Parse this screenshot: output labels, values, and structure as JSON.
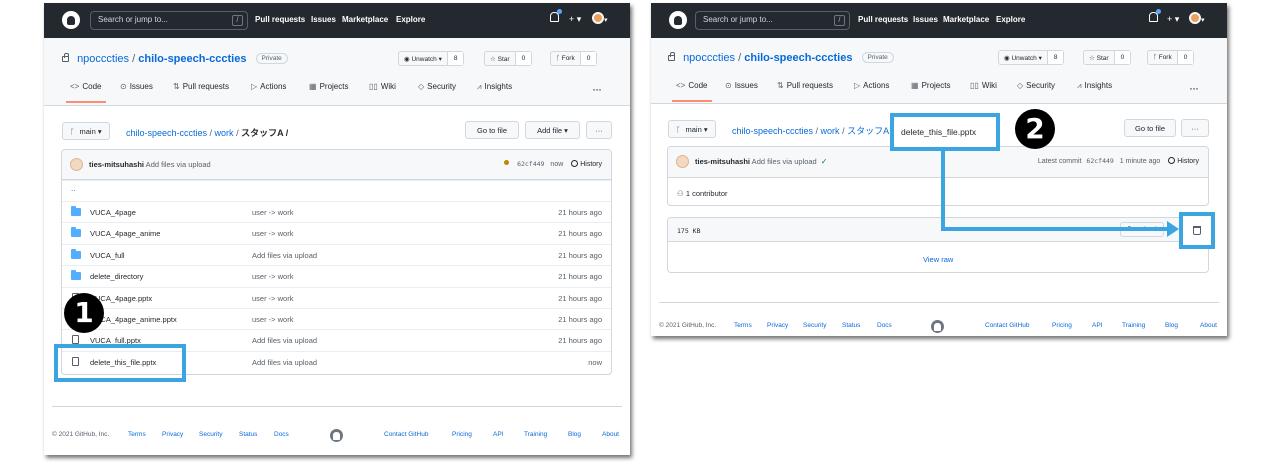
{
  "header": {
    "search_placeholder": "Search or jump to...",
    "slash_key": "/",
    "nav": [
      "Pull requests",
      "Issues",
      "Marketplace",
      "Explore"
    ],
    "plus_menu": "+ ▾",
    "avatar_caret": "▾"
  },
  "repo": {
    "owner": "npocccties",
    "separator": "/",
    "name": "chilo-speech-cccties",
    "visibility": "Private",
    "unwatch_label": "Unwatch ▾",
    "unwatch_count": "8",
    "star_label": "Star",
    "star_count": "0",
    "fork_label": "Fork",
    "fork_count": "0"
  },
  "tabs": [
    {
      "label": "Code",
      "icon": "<>"
    },
    {
      "label": "Issues",
      "icon": "⊙"
    },
    {
      "label": "Pull requests",
      "icon": "⇅"
    },
    {
      "label": "Actions",
      "icon": "▷"
    },
    {
      "label": "Projects",
      "icon": "▦"
    },
    {
      "label": "Wiki",
      "icon": "▯▯"
    },
    {
      "label": "Security",
      "icon": "◇"
    },
    {
      "label": "Insights",
      "icon": "⩘"
    }
  ],
  "more_dots": "···",
  "shot1": {
    "branch": "main ▾",
    "branch_icon": "ᚴ",
    "crumb": {
      "repo": "chilo-speech-cccties",
      "sep1": " / ",
      "dir1": "work",
      "sep2": " / ",
      "dir2": "スタッフA",
      "trail": " /"
    },
    "goto_file": "Go to file",
    "add_file": "Add file ▾",
    "more": "···",
    "commit": {
      "author": "ties-mitsuhashi",
      "message": " Add files via upload",
      "sha": "62cf449",
      "age": "now",
      "history": "History"
    },
    "parent_dir": "..",
    "rows": [
      {
        "type": "dir",
        "name": "VUCA_4page",
        "msg": "user -> work",
        "age": "21 hours ago"
      },
      {
        "type": "dir",
        "name": "VUCA_4page_anime",
        "msg": "user -> work",
        "age": "21 hours ago"
      },
      {
        "type": "dir",
        "name": "VUCA_full",
        "msg": "Add files via upload",
        "age": "21 hours ago"
      },
      {
        "type": "dir",
        "name": "delete_directory",
        "msg": "user -> work",
        "age": "21 hours ago"
      },
      {
        "type": "file",
        "name": "VUCA_4page.pptx",
        "msg": "user -> work",
        "age": "21 hours ago"
      },
      {
        "type": "file",
        "name": "VUCA_4page_anime.pptx",
        "msg": "user -> work",
        "age": "21 hours ago"
      },
      {
        "type": "file",
        "name": "VUCA_full.pptx",
        "msg": "Add files via upload",
        "age": "21 hours ago"
      },
      {
        "type": "file",
        "name": "delete_this_file.pptx",
        "msg": "Add files via upload",
        "age": "now"
      }
    ],
    "step_number": "1"
  },
  "shot2": {
    "branch": "main ▾",
    "crumb": {
      "repo": "chilo-speech-cccties",
      "sep1": " / ",
      "dir1": "work",
      "sep2": " / ",
      "dir2": "スタッフA",
      "file": "delete_this_file.pptx"
    },
    "goto_file": "Go to file",
    "more": "···",
    "commit": {
      "author": "ties-mitsuhashi",
      "message": " Add files via upload",
      "check": "✓",
      "latest": "Latest commit",
      "sha": "62cf449",
      "age": "1 minute ago",
      "history": "History"
    },
    "contributors": "1 contributor",
    "file_size": "175 KB",
    "download": "Download",
    "view_raw": "View raw",
    "step_number": "2"
  },
  "footer": {
    "copyright": "© 2021 GitHub, Inc.",
    "links_left": [
      "Terms",
      "Privacy",
      "Security",
      "Status",
      "Docs"
    ],
    "links_right": [
      "Contact GitHub",
      "Pricing",
      "API",
      "Training",
      "Blog",
      "About"
    ]
  },
  "colors": {
    "header_bg": "#24292f",
    "link": "#0969da",
    "callout": "#3aa5e0",
    "folder": "#54aeff",
    "tab_underline": "#fd8c73"
  }
}
